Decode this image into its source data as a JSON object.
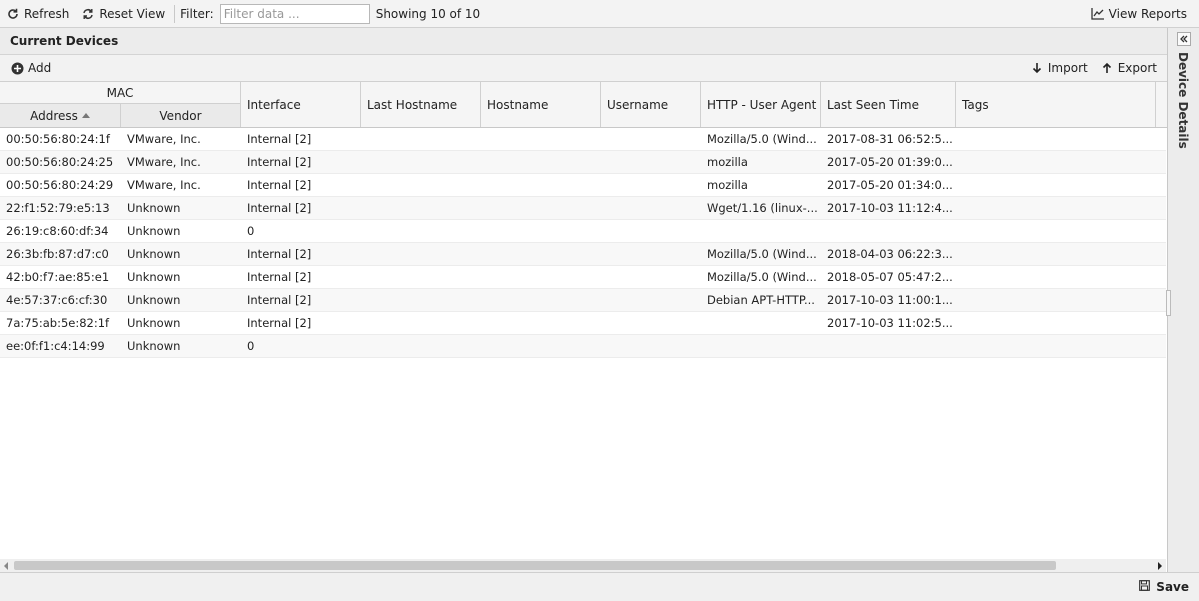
{
  "toolbar": {
    "refresh_label": "Refresh",
    "reset_view_label": "Reset View",
    "filter_label": "Filter:",
    "filter_placeholder": "Filter data ...",
    "showing_text": "Showing 10 of 10",
    "view_reports_label": "View Reports"
  },
  "panel": {
    "title": "Current Devices",
    "add_label": "Add",
    "import_label": "Import",
    "export_label": "Export"
  },
  "columns": {
    "mac_group": "MAC",
    "address": "Address",
    "vendor": "Vendor",
    "interface": "Interface",
    "last_hostname": "Last Hostname",
    "hostname": "Hostname",
    "username": "Username",
    "user_agent": "HTTP - User Agent",
    "last_seen": "Last Seen Time",
    "tags": "Tags"
  },
  "rows": [
    {
      "address": "00:50:56:80:24:1f",
      "vendor": "VMware, Inc.",
      "interface": "Internal [2]",
      "last_hostname": "",
      "hostname": "",
      "username": "",
      "user_agent": "Mozilla/5.0 (Wind...",
      "last_seen": "2017-08-31 06:52:5...",
      "tags": ""
    },
    {
      "address": "00:50:56:80:24:25",
      "vendor": "VMware, Inc.",
      "interface": "Internal [2]",
      "last_hostname": "",
      "hostname": "",
      "username": "",
      "user_agent": "mozilla",
      "last_seen": "2017-05-20 01:39:0...",
      "tags": ""
    },
    {
      "address": "00:50:56:80:24:29",
      "vendor": "VMware, Inc.",
      "interface": "Internal [2]",
      "last_hostname": "",
      "hostname": "",
      "username": "",
      "user_agent": "mozilla",
      "last_seen": "2017-05-20 01:34:0...",
      "tags": ""
    },
    {
      "address": "22:f1:52:79:e5:13",
      "vendor": "Unknown",
      "interface": "Internal [2]",
      "last_hostname": "",
      "hostname": "",
      "username": "",
      "user_agent": "Wget/1.16 (linux-...",
      "last_seen": "2017-10-03 11:12:4...",
      "tags": ""
    },
    {
      "address": "26:19:c8:60:df:34",
      "vendor": "Unknown",
      "interface": "0",
      "last_hostname": "",
      "hostname": "",
      "username": "",
      "user_agent": "",
      "last_seen": "",
      "tags": ""
    },
    {
      "address": "26:3b:fb:87:d7:c0",
      "vendor": "Unknown",
      "interface": "Internal [2]",
      "last_hostname": "",
      "hostname": "",
      "username": "",
      "user_agent": "Mozilla/5.0 (Wind...",
      "last_seen": "2018-04-03 06:22:3...",
      "tags": ""
    },
    {
      "address": "42:b0:f7:ae:85:e1",
      "vendor": "Unknown",
      "interface": "Internal [2]",
      "last_hostname": "",
      "hostname": "",
      "username": "",
      "user_agent": "Mozilla/5.0 (Wind...",
      "last_seen": "2018-05-07 05:47:2...",
      "tags": ""
    },
    {
      "address": "4e:57:37:c6:cf:30",
      "vendor": "Unknown",
      "interface": "Internal [2]",
      "last_hostname": "",
      "hostname": "",
      "username": "",
      "user_agent": "Debian APT-HTTP...",
      "last_seen": "2017-10-03 11:00:1...",
      "tags": ""
    },
    {
      "address": "7a:75:ab:5e:82:1f",
      "vendor": "Unknown",
      "interface": "Internal [2]",
      "last_hostname": "",
      "hostname": "",
      "username": "",
      "user_agent": "",
      "last_seen": "2017-10-03 11:02:5...",
      "tags": ""
    },
    {
      "address": "ee:0f:f1:c4:14:99",
      "vendor": "Unknown",
      "interface": "0",
      "last_hostname": "",
      "hostname": "",
      "username": "",
      "user_agent": "",
      "last_seen": "",
      "tags": ""
    }
  ],
  "side_panel": {
    "title": "Device Details"
  },
  "bottom": {
    "save_label": "Save"
  },
  "icons": {
    "refresh": "refresh-icon",
    "reset": "reset-view-icon",
    "reports": "chart-line-icon",
    "add": "plus-circle-icon",
    "import": "arrow-down-icon",
    "export": "arrow-up-icon",
    "collapse": "double-chevron-left-icon",
    "save": "floppy-disk-icon"
  }
}
